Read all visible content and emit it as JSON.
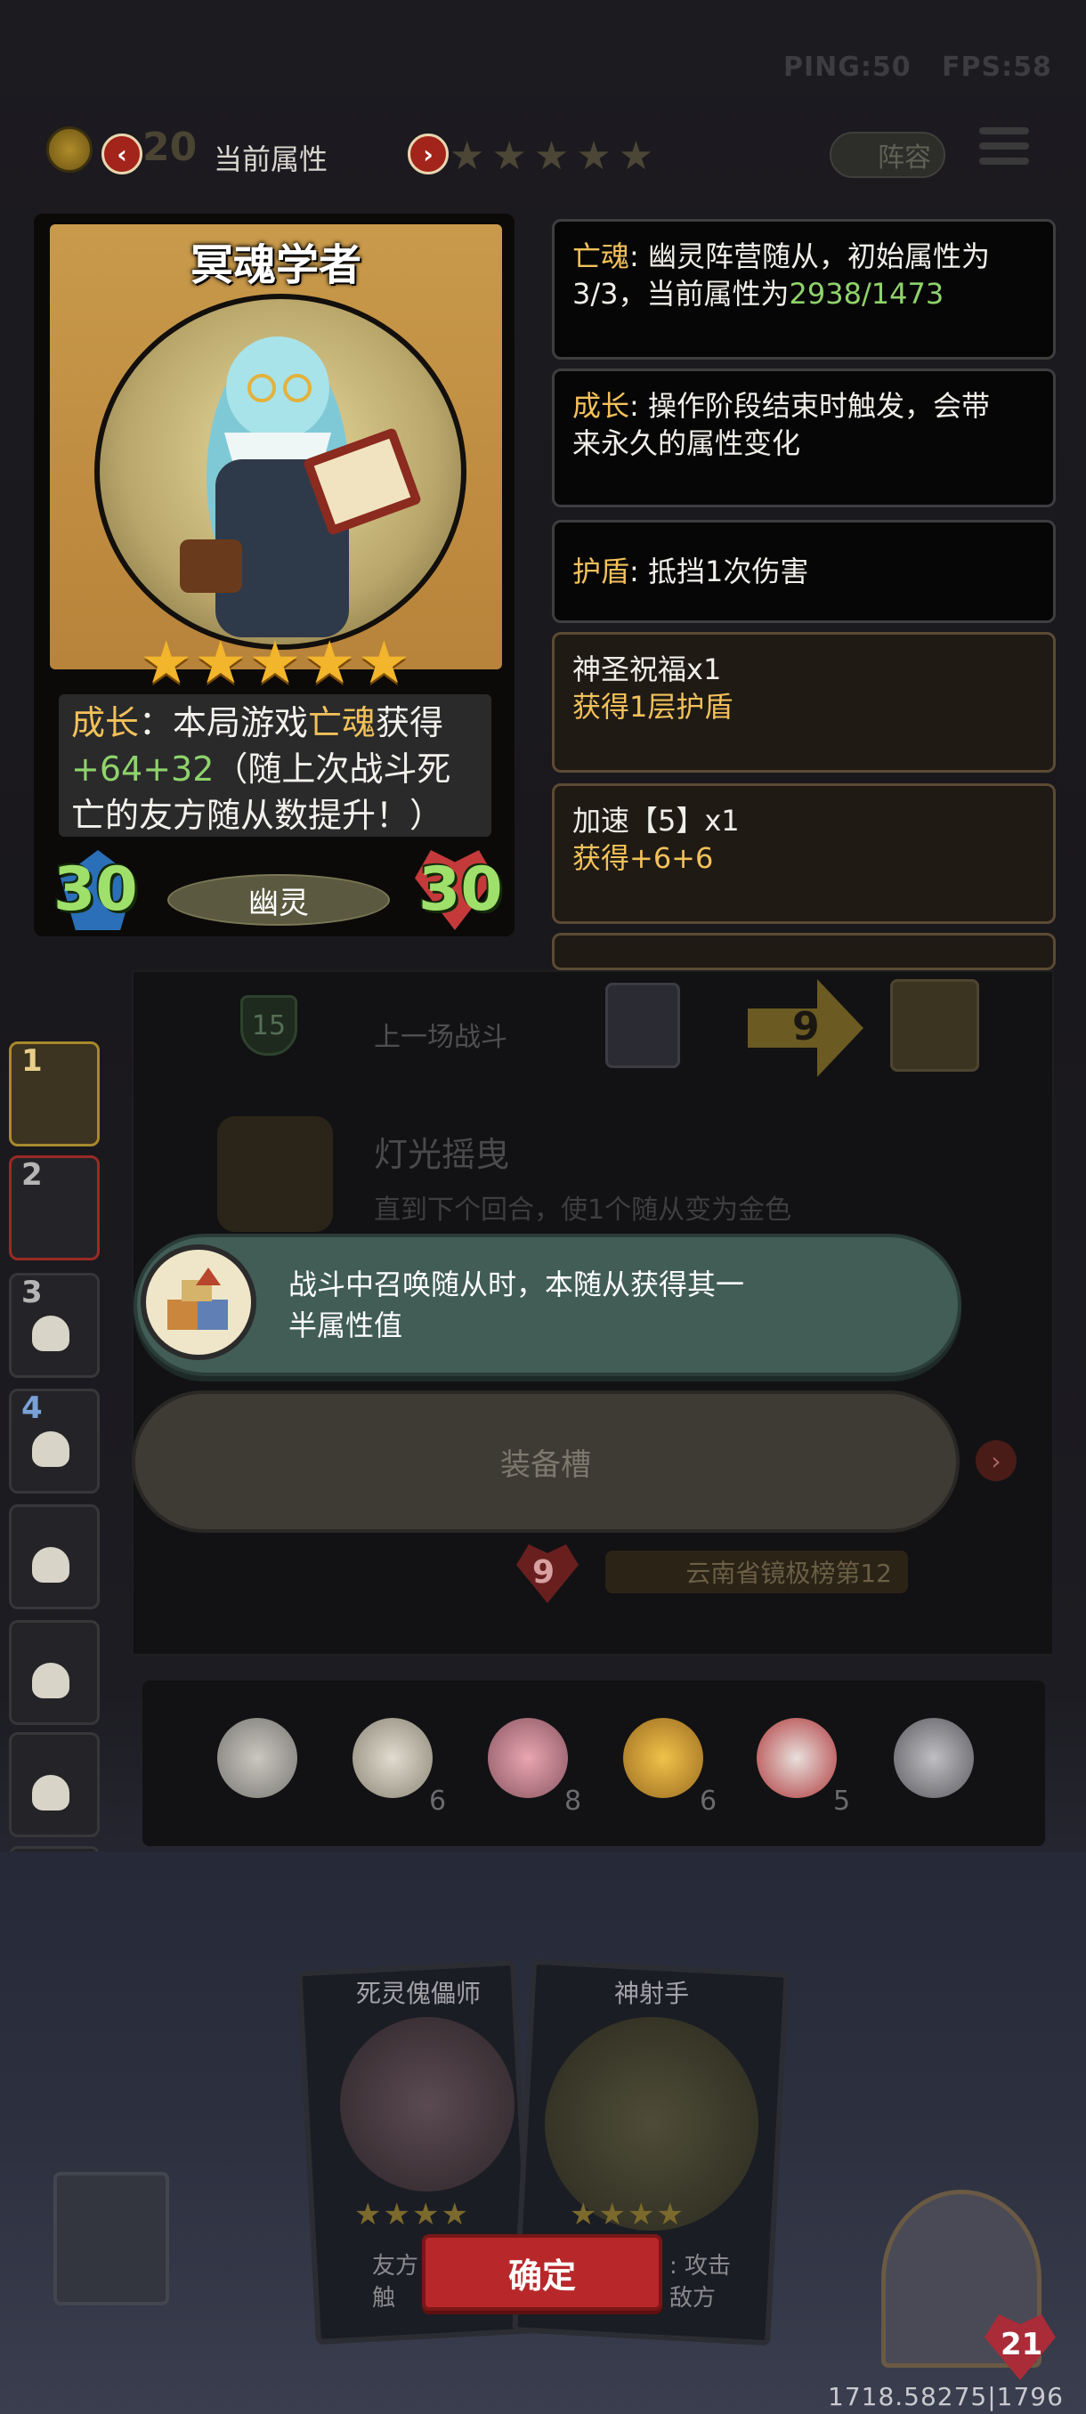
{
  "status": {
    "ping": "PING:50",
    "fps": "FPS:58"
  },
  "header": {
    "coin_value": "20",
    "prev_label": "‹",
    "next_label": "›",
    "title": "当前属性",
    "stars": "★★★★★",
    "team_label": "阵容"
  },
  "hero": {
    "name": "冥魂学者",
    "stars": "★★★★★",
    "desc_line1_a": "成长",
    "desc_line1_b": "：本局游戏",
    "desc_line1_c": "亡魂",
    "desc_line1_d": "获得",
    "desc_line2_a": "+64",
    "desc_line2_b": "+32",
    "desc_line2_c": "（随上次战斗死",
    "desc_line3": "亡的友方随从数提升！）",
    "attack": "30",
    "health": "30",
    "tribe": "幽灵"
  },
  "keywords": [
    {
      "key": "亡魂",
      "text_a": ": 幽灵阵营随从，初始属性为",
      "text_b": "3/3，当前属性为",
      "value": "2938/1473"
    },
    {
      "key": "成长",
      "text_a": ": 操作阶段结束时触发，会带",
      "text_b": "来永久的属性变化"
    },
    {
      "key": "护盾",
      "text_a": ": 抵挡1次伤害"
    },
    {
      "title": "神圣祝福x1",
      "desc": "获得1层护盾"
    },
    {
      "title": "加速【5】x1",
      "desc": "获得+6+6"
    }
  ],
  "battle": {
    "turn": "15",
    "prev_battle_label": "上一场战斗",
    "arrow_value": "9",
    "ghost_title": "灯光摇曳",
    "ghost_desc": "直到下个回合，使1个随从变为金色",
    "rank_heart": "9",
    "rank_label": "云南省镜极榜第12"
  },
  "tooltip": {
    "line1": "战斗中召唤随从时，本随从获得其一",
    "line2": "半属性值"
  },
  "equip": {
    "label": "装备槽",
    "arrow": "›"
  },
  "side_slots": [
    "1",
    "2",
    "3",
    "4"
  ],
  "items": [
    {
      "icon": "alarm-clock-icon",
      "count": ""
    },
    {
      "icon": "teacup-icon",
      "count": "6"
    },
    {
      "icon": "cupcake-icon",
      "count": "8"
    },
    {
      "icon": "chicken-toy-icon",
      "count": "6"
    },
    {
      "icon": "clown-icon",
      "count": "5"
    },
    {
      "icon": "shield-icon",
      "count": ""
    }
  ],
  "cards": {
    "a_name": "死灵傀儡师",
    "a_stars": "★★★★",
    "a_text1": "友方",
    "a_text2": "触",
    "b_name": "神射手",
    "b_stars": "★★★★",
    "b_text1": ": 攻击",
    "b_text2": "敌方"
  },
  "confirm_label": "确定",
  "opponent_health": "21",
  "coords": "1718.58275|1796",
  "colors": {
    "gold": "#f2c15a",
    "green_stat": "#8fd36b",
    "confirm_red": "#b8282a",
    "tooltip_teal": "#415d56"
  }
}
